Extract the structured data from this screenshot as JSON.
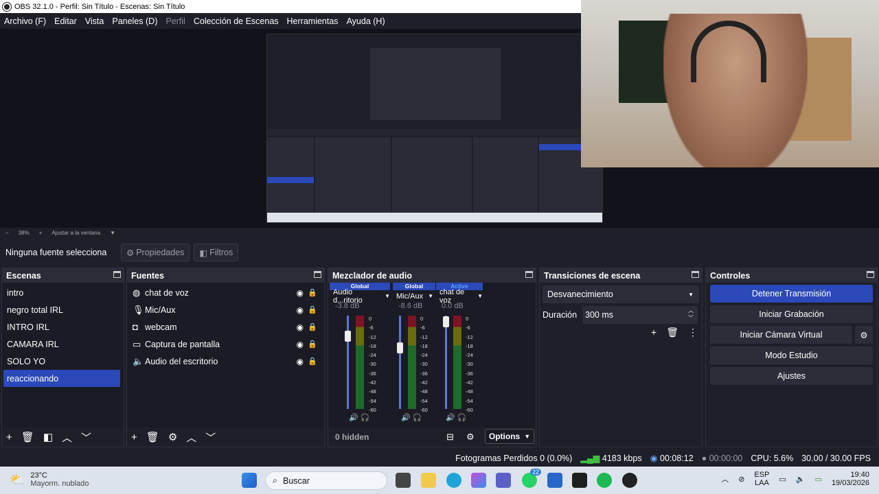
{
  "window": {
    "title": "OBS 32.1.0 - Perfil: Sin Título - Escenas: Sin Título"
  },
  "menu": [
    "Archivo (F)",
    "Editar",
    "Vista",
    "Paneles (D)",
    "Perfil",
    "Colección de Escenas",
    "Herramientas",
    "Ayuda (H)"
  ],
  "zoom": {
    "minus": "−",
    "value": "38%",
    "plus": "+",
    "fit": "Ajustar a la ventana"
  },
  "sourcebar": {
    "label": "Ninguna fuente selecciona",
    "properties": "Propiedades",
    "filters": "Filtros"
  },
  "scenes": {
    "title": "Escenas",
    "items": [
      "intro",
      "negro total IRL",
      "INTRO IRL",
      "CAMARA IRL",
      "SOLO YO",
      "reaccionando"
    ],
    "selected": "reaccionando"
  },
  "sources": {
    "title": "Fuentes",
    "items": [
      {
        "label": "chat de voz",
        "icon": "globe-icon"
      },
      {
        "label": "Mic/Aux",
        "icon": "microphone-icon"
      },
      {
        "label": "webcam",
        "icon": "camera-icon"
      },
      {
        "label": "Captura de pantalla",
        "icon": "monitor-icon"
      },
      {
        "label": "Audio del escritorio",
        "icon": "speaker-icon"
      }
    ]
  },
  "mixer": {
    "title": "Mezclador de audio",
    "channels": [
      {
        "tag": "Global",
        "name": "Audio d...ritorio",
        "db": "-3.8 dB"
      },
      {
        "tag": "Global",
        "name": "Mic/Aux",
        "db": "-8.6 dB"
      },
      {
        "tag": "Active",
        "name": "chat de voz",
        "db": "0.0 dB"
      }
    ],
    "ticks": [
      "0",
      "-6",
      "-12",
      "-18",
      "-24",
      "-30",
      "-36",
      "-42",
      "-48",
      "-54",
      "-60"
    ],
    "hidden": "0 hidden",
    "options": "Options"
  },
  "transitions": {
    "title": "Transiciones de escena",
    "selected": "Desvanecimiento",
    "duration_label": "Duración",
    "duration_value": "300 ms"
  },
  "controls": {
    "title": "Controles",
    "stream": "Detener Transmisión",
    "record": "Iniciar Grabación",
    "virtualcam": "Iniciar Cámara Virtual",
    "studio": "Modo Estudio",
    "settings": "Ajustes"
  },
  "status": {
    "dropped": "Fotogramas Perdidos 0 (0.0%)",
    "bitrate": "4183 kbps",
    "stream_time": "00:08:12",
    "rec_time": "00:00:00",
    "cpu": "CPU: 5.6%",
    "fps": "30.00 / 30.00 FPS"
  },
  "taskbar": {
    "temp": "23°C",
    "weather": "Mayorm. nublado",
    "search": "Buscar",
    "whatsapp_badge": "22",
    "lang1": "ESP",
    "lang2": "LAA",
    "time": "19:40",
    "date": "19/03/2026"
  },
  "colors": {
    "accent": "#2b49b9",
    "panel": "#1e1f29",
    "meter_green": "#1e6b2a",
    "meter_red": "#7d1323"
  }
}
